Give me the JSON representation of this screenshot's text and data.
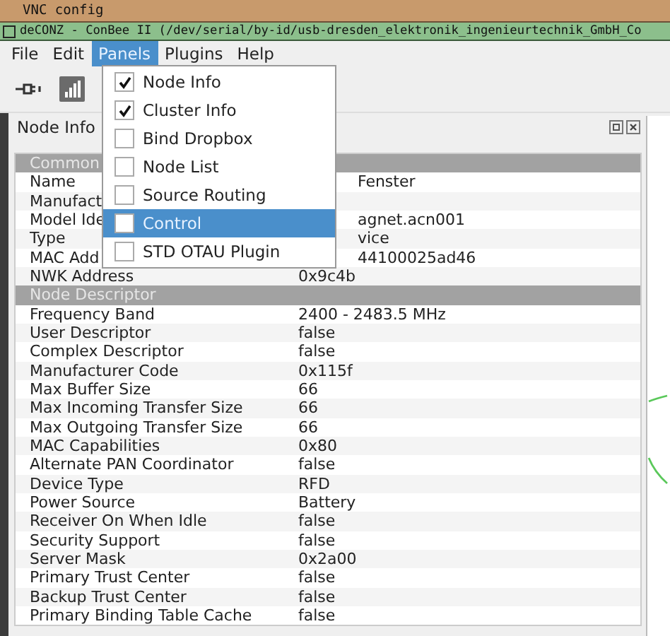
{
  "vnc_window": {
    "title": "VNC config"
  },
  "window": {
    "title": "deCONZ - ConBee II (/dev/serial/by-id/usb-dresden_elektronik_ingenieurtechnik_GmbH_Co"
  },
  "menu_bar": [
    {
      "label": "File",
      "selected": false
    },
    {
      "label": "Edit",
      "selected": false
    },
    {
      "label": "Panels",
      "selected": true
    },
    {
      "label": "Plugins",
      "selected": false
    },
    {
      "label": "Help",
      "selected": false
    }
  ],
  "panels_menu": [
    {
      "label": "Node Info",
      "checked": true,
      "selected": false
    },
    {
      "label": "Cluster Info",
      "checked": true,
      "selected": false
    },
    {
      "label": "Bind Dropbox",
      "checked": false,
      "selected": false
    },
    {
      "label": "Node List",
      "checked": false,
      "selected": false
    },
    {
      "label": "Source Routing",
      "checked": false,
      "selected": false
    },
    {
      "label": "Control",
      "checked": false,
      "selected": true
    },
    {
      "label": "STD OTAU Plugin",
      "checked": false,
      "selected": false
    }
  ],
  "dock": {
    "title": "Node Info"
  },
  "table": {
    "rows": [
      {
        "kind": "section",
        "label": "Common"
      },
      {
        "kind": "property",
        "label": "Name",
        "value": "Fenster",
        "covered": true
      },
      {
        "kind": "property",
        "label": "Manufact"
      },
      {
        "kind": "property",
        "label": "Model Ide",
        "value": "agnet.acn001",
        "covered": true
      },
      {
        "kind": "property",
        "label": "Type",
        "value": "vice",
        "covered": true
      },
      {
        "kind": "property",
        "label": "MAC Add",
        "value": "44100025ad46",
        "covered": true
      },
      {
        "kind": "property",
        "label": "NWK Address",
        "value": "0x9c4b",
        "covered": false
      },
      {
        "kind": "section",
        "label": "Node Descriptor"
      },
      {
        "kind": "property",
        "label": "Frequency Band",
        "value": "2400 - 2483.5 MHz",
        "covered": false
      },
      {
        "kind": "property",
        "label": "User Descriptor",
        "value": "false",
        "covered": false
      },
      {
        "kind": "property",
        "label": "Complex Descriptor",
        "value": "false",
        "covered": false
      },
      {
        "kind": "property",
        "label": "Manufacturer Code",
        "value": "0x115f",
        "covered": false
      },
      {
        "kind": "property",
        "label": "Max Buffer Size",
        "value": "66",
        "covered": false
      },
      {
        "kind": "property",
        "label": "Max Incoming Transfer Size",
        "value": "66",
        "covered": false
      },
      {
        "kind": "property",
        "label": "Max Outgoing Transfer Size",
        "value": "66",
        "covered": false
      },
      {
        "kind": "property",
        "label": "MAC Capabilities",
        "value": "0x80",
        "covered": false
      },
      {
        "kind": "property",
        "label": "Alternate PAN Coordinator",
        "value": "false",
        "covered": false
      },
      {
        "kind": "property",
        "label": "Device Type",
        "value": "RFD",
        "covered": false
      },
      {
        "kind": "property",
        "label": "Power Source",
        "value": "Battery",
        "covered": false
      },
      {
        "kind": "property",
        "label": "Receiver On When Idle",
        "value": "false",
        "covered": false
      },
      {
        "kind": "property",
        "label": "Security Support",
        "value": "false",
        "covered": false
      },
      {
        "kind": "property",
        "label": "Server Mask",
        "value": "0x2a00",
        "covered": false
      },
      {
        "kind": "property",
        "label": "Primary Trust Center",
        "value": "false",
        "covered": false
      },
      {
        "kind": "property",
        "label": "Backup Trust Center",
        "value": "false",
        "covered": false
      },
      {
        "kind": "property",
        "label": "Primary Binding Table Cache",
        "value": "false",
        "covered": false
      }
    ]
  }
}
